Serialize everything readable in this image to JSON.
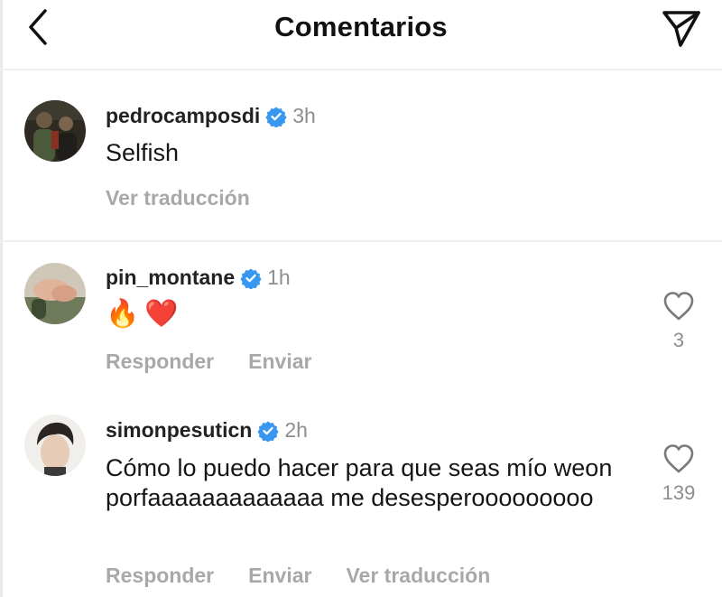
{
  "header": {
    "title": "Comentarios",
    "back_icon": "chevron-left-icon",
    "send_icon": "paper-plane-icon"
  },
  "caption": {
    "username": "pedrocamposdi",
    "verified": true,
    "time": "3h",
    "text": "Selfish",
    "translate_label": "Ver traducción"
  },
  "comments": [
    {
      "username": "pin_montane",
      "verified": true,
      "time": "1h",
      "emojis": [
        "🔥",
        "❤️"
      ],
      "reply_label": "Responder",
      "send_label": "Enviar",
      "likes": "3"
    },
    {
      "username": "simonpesuticn",
      "verified": true,
      "time": "2h",
      "text": "Cómo lo puedo hacer para que seas mío weon porfaaaaaaaaaaaaa me desesperooooooooo",
      "reply_label": "Responder",
      "send_label": "Enviar",
      "translate_label": "Ver traducción",
      "likes": "139"
    }
  ],
  "colors": {
    "verified_blue": "#3897f0",
    "secondary_text": "#8e8e8e",
    "action_text": "#a8a8a8",
    "divider": "#efefef"
  }
}
